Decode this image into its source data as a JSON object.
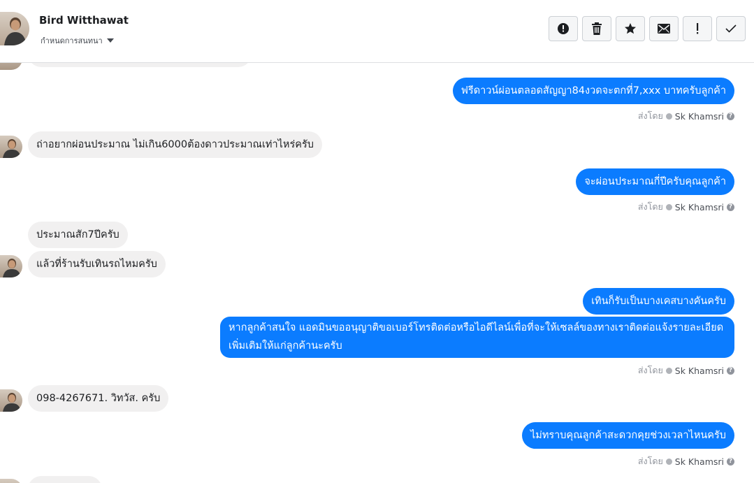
{
  "header": {
    "contact_name": "Bird Witthawat",
    "subtitle": "กำหนดการสนทนา",
    "tools": [
      {
        "icon": "alert-circle-icon",
        "name": "mark-spam-button"
      },
      {
        "icon": "trash-icon",
        "name": "delete-button"
      },
      {
        "icon": "star-icon",
        "name": "star-button"
      },
      {
        "icon": "envelope-icon",
        "name": "mark-unread-button"
      },
      {
        "icon": "exclamation-icon",
        "name": "important-button"
      },
      {
        "icon": "check-icon",
        "name": "mark-done-button"
      }
    ]
  },
  "messages": {
    "m1": "ฟรีดาวน์ผ่อนตลอดสัญญา84งวดจะตกที่7,xxx บาทครับลูกค้า",
    "m2": "ถ่าอยากผ่อนประมาณ ไม่เกิน6000ต้องดาวประมาณเท่าไหร่ครับ",
    "m3": "จะผ่อนประมาณกี่ปีครับคุณลูกค้า",
    "m4": "ประมาณสัก7ปีครับ",
    "m5": "แล้วที่ร้านรับเทินรถไหมครับ",
    "m6": "เทินก็รับเป็นบางเคสบางคันครับ",
    "m7": "หากลูกค้าสนใจ แอดมินขออนุญาติขอเบอร์โทรติดต่อหรือไอดีไลน์เพื่อที่จะให้เซลล์ของทางเราติดต่อแจ้งรายละเอียดเพิ่มเติมให้แก่ลูกค้านะครับ",
    "m8": "098-4267671. วิทวัส.  ครับ",
    "m9": "ไม่ทราบคุณลูกค้าสะดวกคุยช่วงเวลาไหนครับ"
  },
  "sent_by": {
    "prefix": "ส่งโดย",
    "agent": "Sk Khamsri"
  },
  "colors": {
    "outgoing": "#0b7cff",
    "incoming": "#f1f0f0"
  }
}
